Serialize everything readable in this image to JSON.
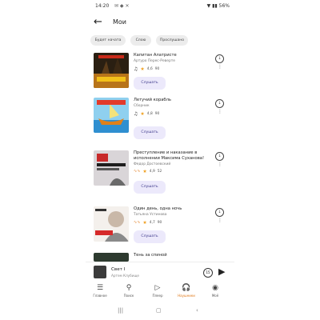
{
  "status": {
    "time": "14:20",
    "battery": "56%"
  },
  "header": {
    "back": "←",
    "title": "Мои"
  },
  "chips": [
    {
      "label": "Будет начата"
    },
    {
      "label": "Слою"
    },
    {
      "label": "Прослушано"
    }
  ],
  "items": [
    {
      "title": "Капитан Алатристе",
      "author": "Артуро Перес-Реверте",
      "rating": "4,6",
      "count": "90",
      "listen": "Слушать"
    },
    {
      "title": "Летучий корабль",
      "author": "Сборник",
      "rating": "4,8",
      "count": "90",
      "listen": "Слушать"
    },
    {
      "title": "Преступление и наказание в исполнении Максима Суханова!",
      "author": "Федор Достоевский",
      "rating": "4,9",
      "count": "52",
      "listen": "Слушать"
    },
    {
      "title": "Один день, одна ночь",
      "author": "Татьяна Устинова",
      "rating": "4,7",
      "count": "90",
      "listen": "Слушать"
    },
    {
      "title": "Тень за спиной"
    }
  ],
  "player": {
    "title": "Свет I",
    "subtitle": "Артем Клубище",
    "rewind": "15"
  },
  "tabs": [
    {
      "label": "Главное",
      "icon": "home-icon"
    },
    {
      "label": "Поиск",
      "icon": "search-icon"
    },
    {
      "label": "Плеер",
      "icon": "play-icon"
    },
    {
      "label": "Наушники",
      "icon": "headphones-icon"
    },
    {
      "label": "Моё",
      "icon": "profile-icon"
    }
  ],
  "colors": {
    "accent": "#e07a1a",
    "listen_bg": "#ece9fb",
    "star": "#f0a020"
  }
}
